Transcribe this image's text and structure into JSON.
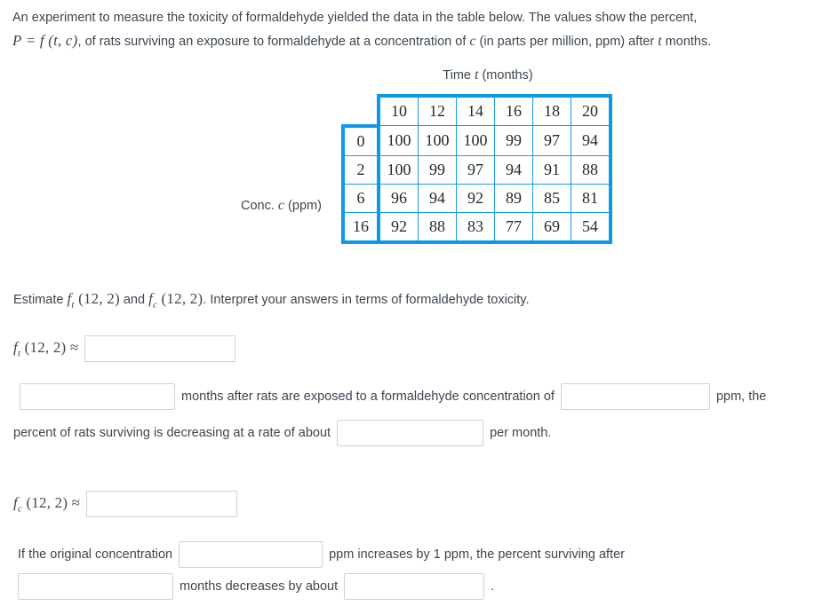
{
  "intro": {
    "line1": "An experiment to measure the toxicity of formaldehyde yielded the data in the table below. The values show the percent,",
    "formula": "P = f (t, c)",
    "line2_rest": ", of rats surviving an exposure to formaldehyde at a concentration of ",
    "var_c": "c",
    "line2_tail": " (in parts per million, ppm) after ",
    "var_t": "t",
    "line2_end": " months."
  },
  "table": {
    "column_header_title": "Time t (months)",
    "column_header_prefix": "Time ",
    "column_header_var": "t",
    "column_header_suffix": " (months)",
    "row_header_title": "Conc. c (ppm)",
    "row_header_prefix": "Conc. ",
    "row_header_var": "c",
    "row_header_suffix": " (ppm)",
    "t_values": [
      "10",
      "12",
      "14",
      "16",
      "18",
      "20"
    ],
    "c_values": [
      "0",
      "2",
      "6",
      "16"
    ],
    "rows": [
      [
        "100",
        "100",
        "100",
        "99",
        "97",
        "94"
      ],
      [
        "100",
        "99",
        "97",
        "94",
        "91",
        "88"
      ],
      [
        "96",
        "94",
        "92",
        "89",
        "85",
        "81"
      ],
      [
        "92",
        "88",
        "83",
        "77",
        "69",
        "54"
      ]
    ],
    "border_color": "#0d99e8",
    "grid_color": "#1a9ae8"
  },
  "question": {
    "estimate_prefix": "Estimate ",
    "f_t_label": "f",
    "f_t_sub": "t",
    "f_t_args": " (12, 2)",
    "and_text": " and ",
    "f_c_label": "f",
    "f_c_sub": "c",
    "f_c_args": " (12, 2)",
    "estimate_suffix": ". Interpret your answers in terms of formaldehyde toxicity."
  },
  "answers": {
    "ft_row": {
      "label_f": "f",
      "label_sub": "t",
      "label_args": " (12, 2) ≈",
      "value": "",
      "placeholder": ""
    },
    "fc_row": {
      "label_f": "f",
      "label_sub": "c",
      "label_args": " (12, 2) ≈",
      "value": "",
      "placeholder": ""
    },
    "sentence1": {
      "blank_months_value": "",
      "text_a": "months after rats are exposed to a formaldehyde concentration of",
      "blank_ppm_value": "",
      "text_b": "ppm, the",
      "text_c": "percent of rats surviving is decreasing at a rate of about",
      "blank_rate_value": "",
      "text_d": "per month."
    },
    "sentence2": {
      "text_a": "If the original concentration",
      "blank_conc_value": "",
      "text_b": "ppm increases by 1 ppm, the percent surviving after",
      "blank_months_value": "",
      "text_c": "months decreases by about",
      "blank_amount_value": "",
      "text_d": "."
    }
  }
}
